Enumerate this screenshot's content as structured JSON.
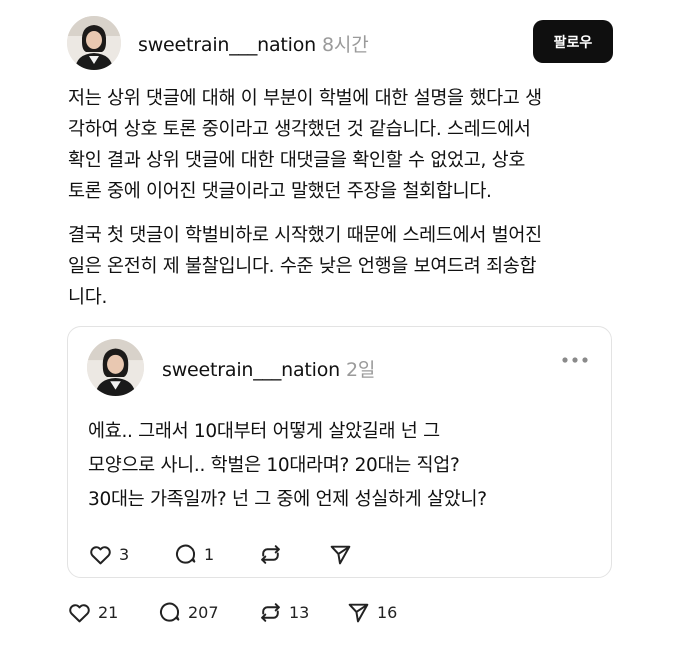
{
  "post": {
    "username": "sweetrain___nation",
    "time": "8시간",
    "follow_label": "팔로우",
    "paragraph1_lines": [
      "저는 상위 댓글에 대해 이 부분이 학벌에 대한 설명을 했다고 생",
      "각하여 상호 토론 중이라고 생각했던 것 같습니다. 스레드에서",
      "확인 결과 상위 댓글에 대한 대댓글을 확인할 수 없었고,  상호",
      "토론 중에 이어진 댓글이라고 말했던 주장을 철회합니다."
    ],
    "paragraph2_lines": [
      "결국 첫 댓글이 학벌비하로 시작했기 때문에 스레드에서 벌어진",
      "일은 온전히 제 불찰입니다. 수준 낮은 언행을 보여드려 죄송합",
      "니다."
    ],
    "actions": {
      "likes": "21",
      "replies": "207",
      "reposts": "13",
      "shares": "16"
    }
  },
  "quote": {
    "username": "sweetrain___nation",
    "time": "2일",
    "text_lines": [
      "에효.. 그래서 10대부터 어떻게 살았길래 넌 그",
      "모양으로 사니.. 학벌은 10대라며? 20대는 직업?",
      "30대는 가족일까? 넌 그 중에 언제 성실하게 살았니?"
    ],
    "actions": {
      "likes": "3",
      "replies": "1"
    }
  },
  "icons": {
    "like": "heart-icon",
    "reply": "comment-icon",
    "repost": "repost-icon",
    "share": "send-icon",
    "more": "more-dots-icon"
  },
  "colors": {
    "button_bg": "#0f0f0f",
    "muted": "#9a9a9a",
    "border": "#e3e3e3"
  }
}
